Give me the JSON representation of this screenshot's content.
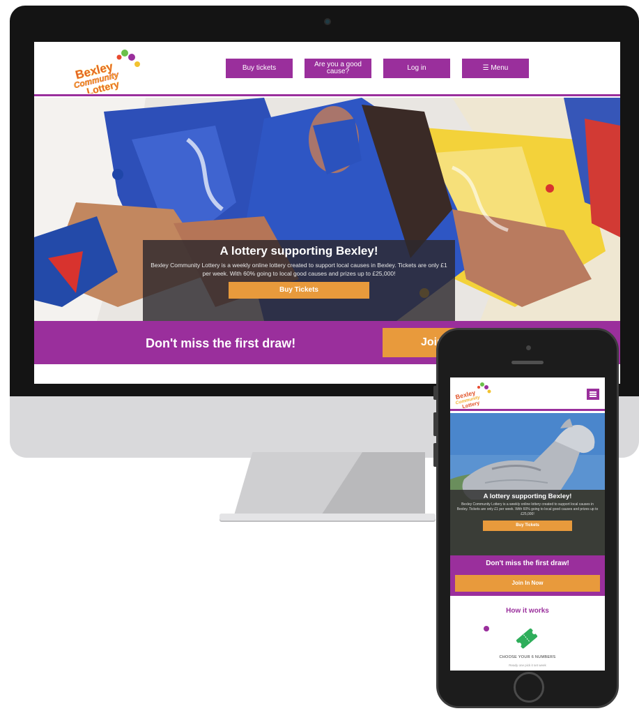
{
  "brand": {
    "logo_line1": "Bexley",
    "logo_line2": "Community",
    "logo_line3": "Lottery",
    "purple": "#9a2f9c",
    "orange": "#e89a3c"
  },
  "desktop": {
    "nav": [
      {
        "label": "Buy tickets"
      },
      {
        "label": "Are you a good cause?"
      },
      {
        "label": "Log in"
      },
      {
        "label": "☰ Menu"
      }
    ],
    "hero": {
      "title": "A lottery supporting Bexley!",
      "body": "Bexley Community Lottery is a weekly online lottery created to support local causes in Bexley. Tickets are only £1 per week. With 60% going to local good causes and prizes up to £25,000!",
      "cta": "Buy Tickets"
    },
    "band": {
      "text": "Don't miss the first draw!",
      "cta": "Join In Now"
    }
  },
  "mobile": {
    "hero": {
      "title": "A lottery supporting Bexley!",
      "body": "Bexley Community Lottery is a weekly online lottery created to support local causes in Bexley. Tickets are only £1 per week. With 60% going to local good causes and prizes up to £25,000!",
      "cta": "Buy Tickets"
    },
    "band": {
      "text": "Don't miss the first draw!",
      "cta": "Join In Now"
    },
    "how": {
      "title": "How it works",
      "step1": "CHOOSE YOUR 6 NUMBERS",
      "step1_sub": "Ready one pick it set week"
    }
  }
}
